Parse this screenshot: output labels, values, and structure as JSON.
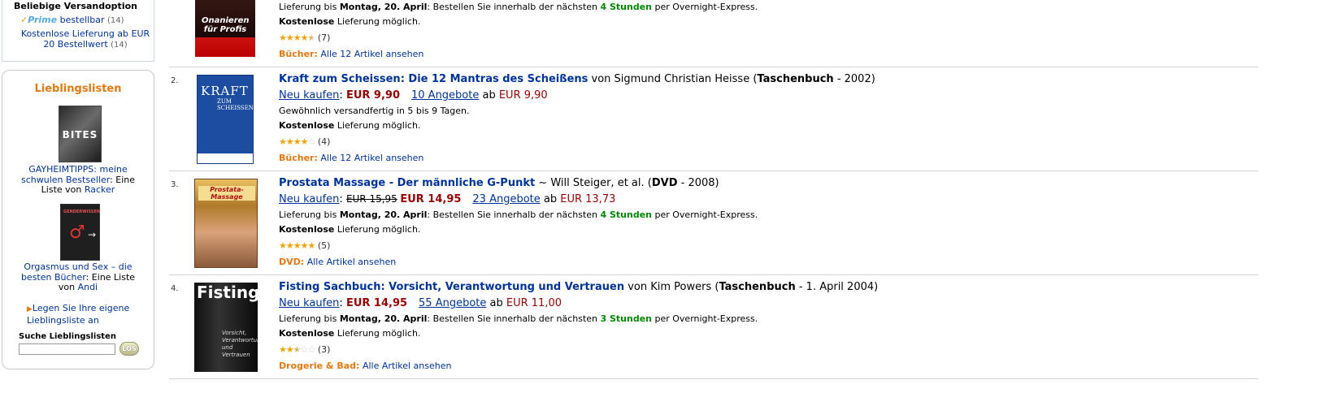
{
  "sidebar": {
    "shipping": {
      "heading": "Beliebige Versandoption",
      "prime_logo": "Prime",
      "prime_link": "bestellbar",
      "prime_count": "(14)",
      "free_link": "Kostenlose Lieferung ab EUR 20 Bestellwert",
      "free_count": "(14)"
    },
    "lists": {
      "title": "Lieblingslisten",
      "items": [
        {
          "cover_text": "BITES",
          "title_link": "GAYHEIMTIPPS: meine schwulen Bestseller",
          "middle": ": Eine Liste von ",
          "author": "Racker"
        },
        {
          "cover_text": "GENDERWISSEN",
          "title_link": "Orgasmus und Sex – die besten Bücher",
          "middle": ": Eine Liste von ",
          "author": "Andi"
        }
      ],
      "create_link": "Legen Sie Ihre eigene Lieblingsliste an",
      "search_label": "Suche Lieblingslisten",
      "search_value": "",
      "search_button": "LOS"
    }
  },
  "results": [
    {
      "cover_text": "Onanieren für Profis",
      "delivery": {
        "prefix": "Lieferung bis ",
        "date": "Montag, 20. April",
        "mid": ": Bestellen Sie innerhalb der nächsten ",
        "hours": "4 Stunden",
        "suffix": " per Overnight-Express."
      },
      "free_bold": "Kostenlose",
      "free_rest": " Lieferung möglich.",
      "rating_count": "(7)",
      "rating": 4.5,
      "category": "Bücher:",
      "category_link": "Alle 12 Artikel ansehen"
    },
    {
      "number": "2.",
      "cover_text": "KRAFT",
      "cover_sub": "ZUM SCHEISSEN",
      "title": "Kraft zum Scheissen: Die 12 Mantras des Scheißens",
      "author_prefix": " von Sigmund Christian Heisse (",
      "format": "Taschenbuch",
      "year": " - 2002)",
      "buy_label": "Neu kaufen",
      "buy_sep": ": ",
      "price": "EUR 9,90",
      "offers": "10 Angebote",
      "offers_from": " ab ",
      "offers_price": "EUR 9,90",
      "availability": "Gewöhnlich versandfertig in 5 bis 9 Tagen.",
      "free_bold": "Kostenlose",
      "free_rest": " Lieferung möglich.",
      "rating_count": "(4)",
      "rating": 4,
      "category": "Bücher:",
      "category_link": "Alle 12 Artikel ansehen"
    },
    {
      "number": "3.",
      "cover_text": "Prostata-Massage",
      "title": "Prostata Massage - Der männliche G-Punkt",
      "author_prefix": " ~ Will Steiger, et al. (",
      "format": "DVD",
      "year": " - 2008)",
      "buy_label": "Neu kaufen",
      "buy_sep": ": ",
      "old_price": "EUR 15,95",
      "price": "EUR 14,95",
      "offers": "23 Angebote",
      "offers_from": " ab ",
      "offers_price": "EUR 13,73",
      "delivery": {
        "prefix": "Lieferung bis ",
        "date": "Montag, 20. April",
        "mid": ": Bestellen Sie innerhalb der nächsten ",
        "hours": "4 Stunden",
        "suffix": " per Overnight-Express."
      },
      "free_bold": "Kostenlose",
      "free_rest": " Lieferung möglich.",
      "rating_count": "(5)",
      "rating": 5,
      "category": "DVD:",
      "category_link": "Alle Artikel ansehen"
    },
    {
      "number": "4.",
      "cover_text": "Fisting",
      "cover_sub": "Vorsicht, Verantwortung und Vertrauen",
      "title": "Fisting Sachbuch: Vorsicht, Verantwortung und Vertrauen",
      "author_prefix": " von Kim Powers (",
      "format": "Taschenbuch",
      "year": " - 1. April 2004)",
      "buy_label": "Neu kaufen",
      "buy_sep": ": ",
      "price": "EUR 14,95",
      "offers": "55 Angebote",
      "offers_from": " ab ",
      "offers_price": "EUR 11,00",
      "delivery": {
        "prefix": "Lieferung bis ",
        "date": "Montag, 20. April",
        "mid": ": Bestellen Sie innerhalb der nächsten ",
        "hours": "3 Stunden",
        "suffix": " per Overnight-Express."
      },
      "free_bold": "Kostenlose",
      "free_rest": " Lieferung möglich.",
      "rating_count": "(3)",
      "rating": 2.5,
      "category": "Drogerie & Bad:",
      "category_link": "Alle Artikel ansehen"
    }
  ],
  "colors": {
    "link": "#003399",
    "price": "#990000",
    "accent": "#e47911",
    "green": "#008a00",
    "star": "#f0a30a"
  },
  "icons": {
    "star": "star-icon",
    "prime_check": "check-icon",
    "bullet": "triangle-right-icon"
  }
}
